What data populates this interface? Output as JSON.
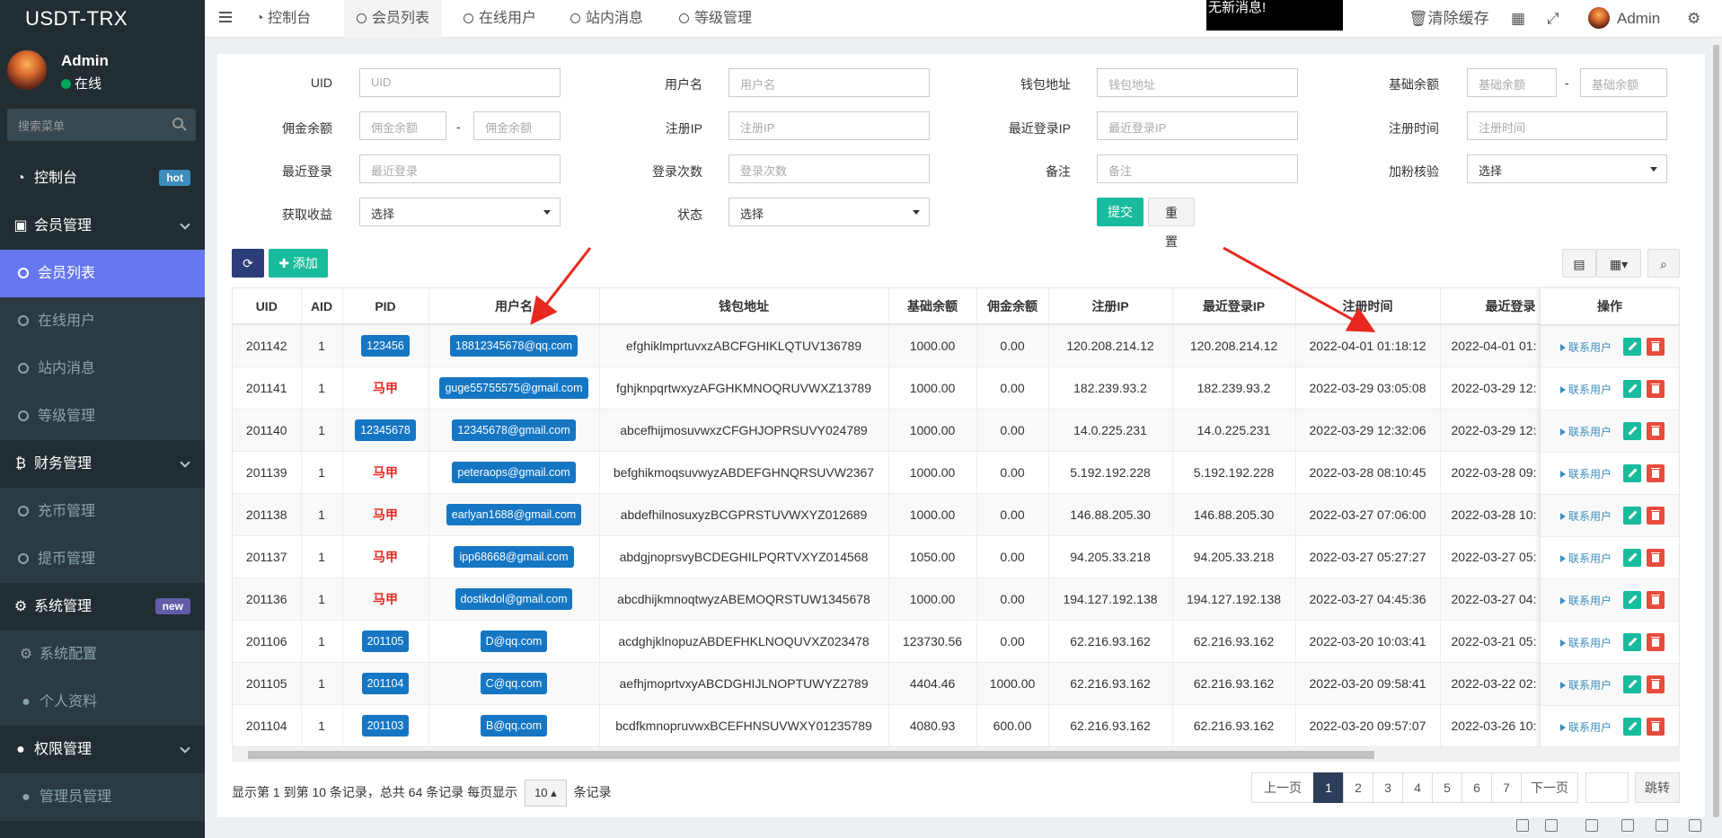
{
  "app": {
    "title": "USDT-TRX"
  },
  "user": {
    "name": "Admin",
    "status": "在线"
  },
  "sidebar": {
    "search_placeholder": "搜索菜单",
    "items": [
      {
        "label": "控制台",
        "badge": "hot"
      },
      {
        "label": "会员管理"
      },
      {
        "label": "会员列表"
      },
      {
        "label": "在线用户"
      },
      {
        "label": "站内消息"
      },
      {
        "label": "等级管理"
      },
      {
        "label": "财务管理"
      },
      {
        "label": "充币管理"
      },
      {
        "label": "提币管理"
      },
      {
        "label": "系统管理",
        "badge": "new"
      },
      {
        "label": "系统配置"
      },
      {
        "label": "个人资料"
      },
      {
        "label": "权限管理"
      },
      {
        "label": "管理员管理"
      }
    ]
  },
  "topbar": {
    "tabs": [
      "控制台",
      "会员列表",
      "在线用户",
      "站内消息",
      "等级管理"
    ],
    "notice": "无新消息!",
    "clear_cache": "清除缓存",
    "admin": "Admin"
  },
  "filters": {
    "uid": {
      "label": "UID",
      "placeholder": "UID"
    },
    "username": {
      "label": "用户名",
      "placeholder": "用户名"
    },
    "wallet": {
      "label": "钱包地址",
      "placeholder": "钱包地址"
    },
    "base_balance": {
      "label": "基础余额",
      "placeholder_min": "基础余额",
      "placeholder_max": "基础余额"
    },
    "commission": {
      "label": "佣金余额",
      "placeholder_min": "佣金余额",
      "placeholder_max": "佣金余额"
    },
    "reg_ip": {
      "label": "注册IP",
      "placeholder": "注册IP"
    },
    "last_ip": {
      "label": "最近登录IP",
      "placeholder": "最近登录IP"
    },
    "reg_time": {
      "label": "注册时间",
      "placeholder": "注册时间"
    },
    "last_login": {
      "label": "最近登录",
      "placeholder": "最近登录"
    },
    "login_count": {
      "label": "登录次数",
      "placeholder": "登录次数"
    },
    "remark": {
      "label": "备注",
      "placeholder": "备注"
    },
    "fans_check": {
      "label": "加粉核验",
      "value": "选择"
    },
    "earnings": {
      "label": "获取收益",
      "value": "选择"
    },
    "status": {
      "label": "状态",
      "value": "选择"
    },
    "submit": "提交",
    "reset": "重置",
    "dash": "-"
  },
  "toolbar": {
    "add": "添加"
  },
  "table": {
    "headers": [
      "UID",
      "AID",
      "PID",
      "用户名",
      "钱包地址",
      "基础余额",
      "佣金余额",
      "注册IP",
      "最近登录IP",
      "注册时间",
      "最近登录"
    ],
    "ops_header": "操作",
    "contact_label": "联系用户",
    "rows": [
      [
        "201142",
        "1",
        "123456",
        "18812345678@qq.com",
        "efghiklmprtuvxzABCFGHIKLQTUV136789",
        "1000.00",
        "0.00",
        "120.208.214.12",
        "120.208.214.12",
        "2022-04-01 01:18:12",
        "2022-04-01 01:"
      ],
      [
        "201141",
        "1",
        "马甲",
        "guge55755575@gmail.com",
        "fghjknpqrtwxyzAFGHKMNOQRUVWXZ13789",
        "1000.00",
        "0.00",
        "182.239.93.2",
        "182.239.93.2",
        "2022-03-29 03:05:08",
        "2022-03-29 12:"
      ],
      [
        "201140",
        "1",
        "12345678",
        "12345678@gmail.com",
        "abcefhijmosuvwxzCFGHJOPRSUVY024789",
        "1000.00",
        "0.00",
        "14.0.225.231",
        "14.0.225.231",
        "2022-03-29 12:32:06",
        "2022-03-29 12:"
      ],
      [
        "201139",
        "1",
        "马甲",
        "peteraops@gmail.com",
        "befghikmoqsuvwyzABDEFGHNQRSUVW2367",
        "1000.00",
        "0.00",
        "5.192.192.228",
        "5.192.192.228",
        "2022-03-28 08:10:45",
        "2022-03-28 09:"
      ],
      [
        "201138",
        "1",
        "马甲",
        "earlyan1688@gmail.com",
        "abdefhilnosuxyzBCGPRSTUVWXYZ012689",
        "1000.00",
        "0.00",
        "146.88.205.30",
        "146.88.205.30",
        "2022-03-27 07:06:00",
        "2022-03-28 10:"
      ],
      [
        "201137",
        "1",
        "马甲",
        "ipp68668@gmail.com",
        "abdgjnoprsvyBCDEGHILPQRTVXYZ014568",
        "1050.00",
        "0.00",
        "94.205.33.218",
        "94.205.33.218",
        "2022-03-27 05:27:27",
        "2022-03-27 05:"
      ],
      [
        "201136",
        "1",
        "马甲",
        "dostikdol@gmail.com",
        "abcdhijkmnoqtwyzABEMOQRSTUW1345678",
        "1000.00",
        "0.00",
        "194.127.192.138",
        "194.127.192.138",
        "2022-03-27 04:45:36",
        "2022-03-27 04:"
      ],
      [
        "201106",
        "1",
        "201105",
        "D@qq.com",
        "acdghjklnopuzABDEFHKLNOQUVXZ023478",
        "123730.56",
        "0.00",
        "62.216.93.162",
        "62.216.93.162",
        "2022-03-20 10:03:41",
        "2022-03-21 05:"
      ],
      [
        "201105",
        "1",
        "201104",
        "C@qq.com",
        "aefhjmoprtvxyABCDGHIJLNOPTUWYZ2789",
        "4404.46",
        "1000.00",
        "62.216.93.162",
        "62.216.93.162",
        "2022-03-20 09:58:41",
        "2022-03-22 02:"
      ],
      [
        "201104",
        "1",
        "201103",
        "B@qq.com",
        "bcdfkmnopruvwxBCEFHNSUVWXY01235789",
        "4080.93",
        "600.00",
        "62.216.93.162",
        "62.216.93.162",
        "2022-03-20 09:57:07",
        "2022-03-26 10:"
      ]
    ]
  },
  "pagination": {
    "summary_prefix": "显示第 1 到第 10 条记录，总共 64 条记录 每页显示",
    "page_size": "10",
    "summary_suffix": "条记录",
    "prev": "上一页",
    "pages": [
      "1",
      "2",
      "3",
      "4",
      "5",
      "6",
      "7"
    ],
    "next": "下一页",
    "jump": "跳转"
  },
  "colors": {
    "sidebar_bg": "#222d32",
    "active": "#6777ef",
    "green": "#18bc9c",
    "red": "#e74c3c",
    "pill": "#1576c4",
    "mj": "#e8281f"
  }
}
